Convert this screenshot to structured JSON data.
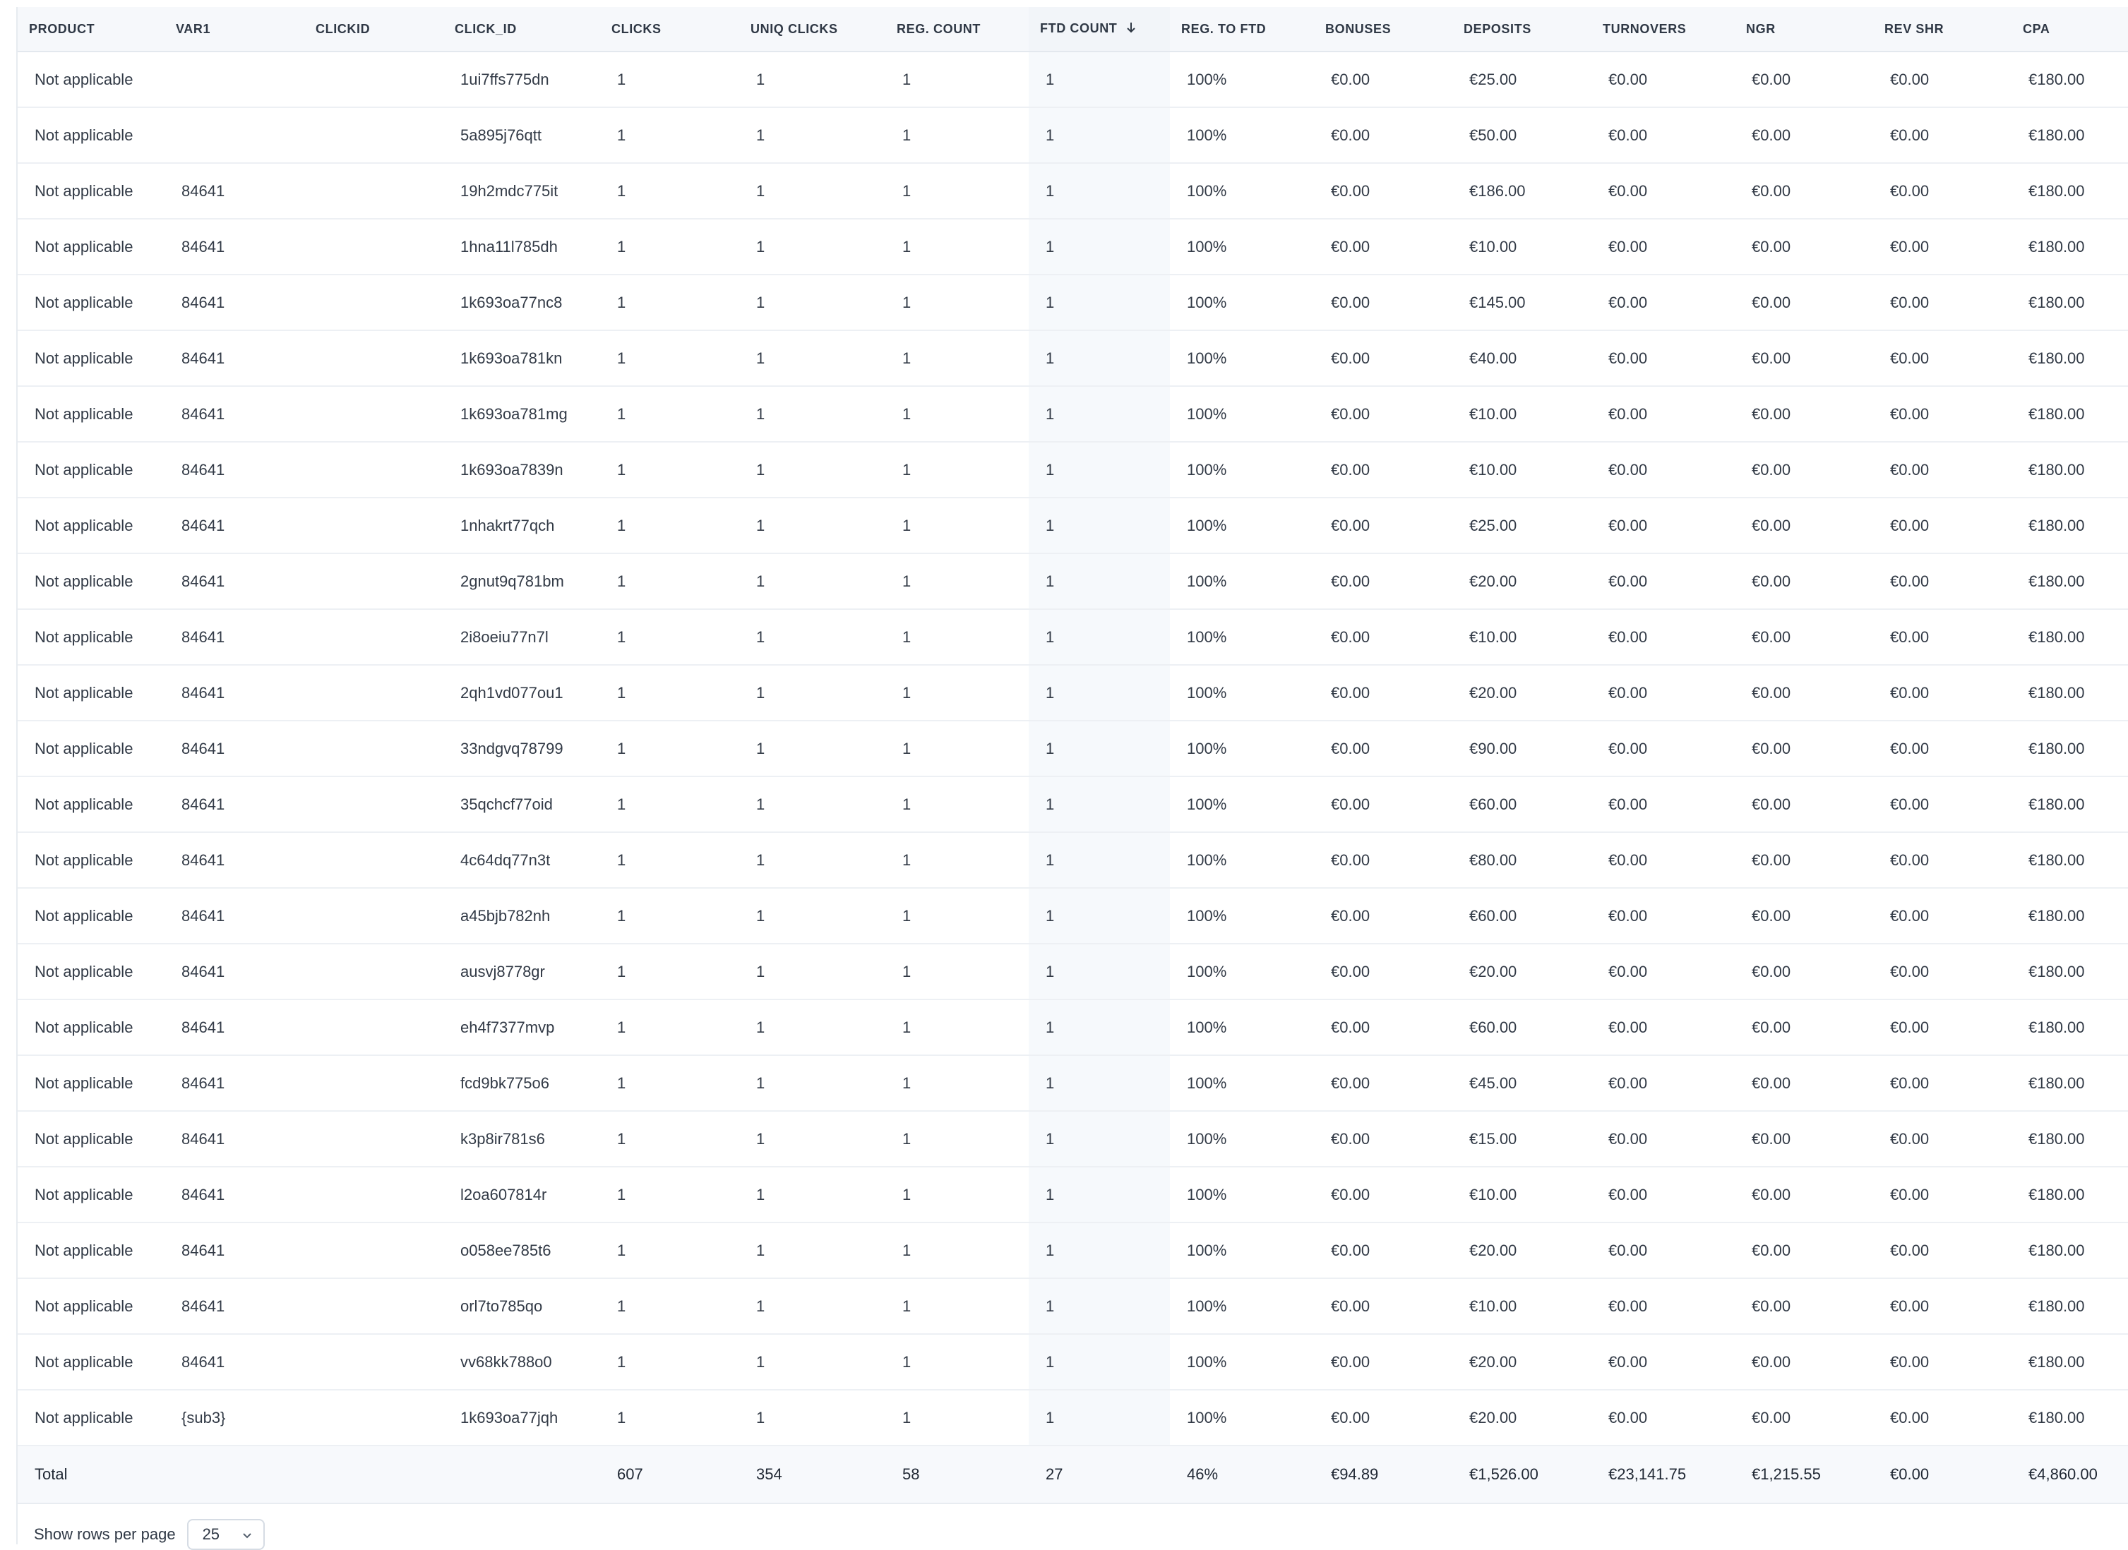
{
  "table": {
    "columns": [
      "PRODUCT",
      "VAR1",
      "CLICKID",
      "CLICK_ID",
      "CLICKS",
      "UNIQ CLICKS",
      "REG. COUNT",
      "FTD COUNT",
      "REG. TO FTD",
      "BONUSES",
      "DEPOSITS",
      "TURNOVERS",
      "NGR",
      "REV SHR",
      "CPA"
    ],
    "sorted_column_index": 7,
    "rows": [
      [
        "Not applicable",
        "",
        "",
        "1ui7ffs775dn",
        "1",
        "1",
        "1",
        "1",
        "100%",
        "€0.00",
        "€25.00",
        "€0.00",
        "€0.00",
        "€0.00",
        "€180.00"
      ],
      [
        "Not applicable",
        "",
        "",
        "5a895j76qtt",
        "1",
        "1",
        "1",
        "1",
        "100%",
        "€0.00",
        "€50.00",
        "€0.00",
        "€0.00",
        "€0.00",
        "€180.00"
      ],
      [
        "Not applicable",
        "84641",
        "",
        "19h2mdc775it",
        "1",
        "1",
        "1",
        "1",
        "100%",
        "€0.00",
        "€186.00",
        "€0.00",
        "€0.00",
        "€0.00",
        "€180.00"
      ],
      [
        "Not applicable",
        "84641",
        "",
        "1hna11l785dh",
        "1",
        "1",
        "1",
        "1",
        "100%",
        "€0.00",
        "€10.00",
        "€0.00",
        "€0.00",
        "€0.00",
        "€180.00"
      ],
      [
        "Not applicable",
        "84641",
        "",
        "1k693oa77nc8",
        "1",
        "1",
        "1",
        "1",
        "100%",
        "€0.00",
        "€145.00",
        "€0.00",
        "€0.00",
        "€0.00",
        "€180.00"
      ],
      [
        "Not applicable",
        "84641",
        "",
        "1k693oa781kn",
        "1",
        "1",
        "1",
        "1",
        "100%",
        "€0.00",
        "€40.00",
        "€0.00",
        "€0.00",
        "€0.00",
        "€180.00"
      ],
      [
        "Not applicable",
        "84641",
        "",
        "1k693oa781mg",
        "1",
        "1",
        "1",
        "1",
        "100%",
        "€0.00",
        "€10.00",
        "€0.00",
        "€0.00",
        "€0.00",
        "€180.00"
      ],
      [
        "Not applicable",
        "84641",
        "",
        "1k693oa7839n",
        "1",
        "1",
        "1",
        "1",
        "100%",
        "€0.00",
        "€10.00",
        "€0.00",
        "€0.00",
        "€0.00",
        "€180.00"
      ],
      [
        "Not applicable",
        "84641",
        "",
        "1nhakrt77qch",
        "1",
        "1",
        "1",
        "1",
        "100%",
        "€0.00",
        "€25.00",
        "€0.00",
        "€0.00",
        "€0.00",
        "€180.00"
      ],
      [
        "Not applicable",
        "84641",
        "",
        "2gnut9q781bm",
        "1",
        "1",
        "1",
        "1",
        "100%",
        "€0.00",
        "€20.00",
        "€0.00",
        "€0.00",
        "€0.00",
        "€180.00"
      ],
      [
        "Not applicable",
        "84641",
        "",
        "2i8oeiu77n7l",
        "1",
        "1",
        "1",
        "1",
        "100%",
        "€0.00",
        "€10.00",
        "€0.00",
        "€0.00",
        "€0.00",
        "€180.00"
      ],
      [
        "Not applicable",
        "84641",
        "",
        "2qh1vd077ou1",
        "1",
        "1",
        "1",
        "1",
        "100%",
        "€0.00",
        "€20.00",
        "€0.00",
        "€0.00",
        "€0.00",
        "€180.00"
      ],
      [
        "Not applicable",
        "84641",
        "",
        "33ndgvq78799",
        "1",
        "1",
        "1",
        "1",
        "100%",
        "€0.00",
        "€90.00",
        "€0.00",
        "€0.00",
        "€0.00",
        "€180.00"
      ],
      [
        "Not applicable",
        "84641",
        "",
        "35qchcf77oid",
        "1",
        "1",
        "1",
        "1",
        "100%",
        "€0.00",
        "€60.00",
        "€0.00",
        "€0.00",
        "€0.00",
        "€180.00"
      ],
      [
        "Not applicable",
        "84641",
        "",
        "4c64dq77n3t",
        "1",
        "1",
        "1",
        "1",
        "100%",
        "€0.00",
        "€80.00",
        "€0.00",
        "€0.00",
        "€0.00",
        "€180.00"
      ],
      [
        "Not applicable",
        "84641",
        "",
        "a45bjb782nh",
        "1",
        "1",
        "1",
        "1",
        "100%",
        "€0.00",
        "€60.00",
        "€0.00",
        "€0.00",
        "€0.00",
        "€180.00"
      ],
      [
        "Not applicable",
        "84641",
        "",
        "ausvj8778gr",
        "1",
        "1",
        "1",
        "1",
        "100%",
        "€0.00",
        "€20.00",
        "€0.00",
        "€0.00",
        "€0.00",
        "€180.00"
      ],
      [
        "Not applicable",
        "84641",
        "",
        "eh4f7377mvp",
        "1",
        "1",
        "1",
        "1",
        "100%",
        "€0.00",
        "€60.00",
        "€0.00",
        "€0.00",
        "€0.00",
        "€180.00"
      ],
      [
        "Not applicable",
        "84641",
        "",
        "fcd9bk775o6",
        "1",
        "1",
        "1",
        "1",
        "100%",
        "€0.00",
        "€45.00",
        "€0.00",
        "€0.00",
        "€0.00",
        "€180.00"
      ],
      [
        "Not applicable",
        "84641",
        "",
        "k3p8ir781s6",
        "1",
        "1",
        "1",
        "1",
        "100%",
        "€0.00",
        "€15.00",
        "€0.00",
        "€0.00",
        "€0.00",
        "€180.00"
      ],
      [
        "Not applicable",
        "84641",
        "",
        "l2oa607814r",
        "1",
        "1",
        "1",
        "1",
        "100%",
        "€0.00",
        "€10.00",
        "€0.00",
        "€0.00",
        "€0.00",
        "€180.00"
      ],
      [
        "Not applicable",
        "84641",
        "",
        "o058ee785t6",
        "1",
        "1",
        "1",
        "1",
        "100%",
        "€0.00",
        "€20.00",
        "€0.00",
        "€0.00",
        "€0.00",
        "€180.00"
      ],
      [
        "Not applicable",
        "84641",
        "",
        "orl7to785qo",
        "1",
        "1",
        "1",
        "1",
        "100%",
        "€0.00",
        "€10.00",
        "€0.00",
        "€0.00",
        "€0.00",
        "€180.00"
      ],
      [
        "Not applicable",
        "84641",
        "",
        "vv68kk788o0",
        "1",
        "1",
        "1",
        "1",
        "100%",
        "€0.00",
        "€20.00",
        "€0.00",
        "€0.00",
        "€0.00",
        "€180.00"
      ],
      [
        "Not applicable",
        "{sub3}",
        "",
        "1k693oa77jqh",
        "1",
        "1",
        "1",
        "1",
        "100%",
        "€0.00",
        "€20.00",
        "€0.00",
        "€0.00",
        "€0.00",
        "€180.00"
      ]
    ],
    "total": [
      "Total",
      "",
      "",
      "",
      "607",
      "354",
      "58",
      "27",
      "46%",
      "€94.89",
      "€1,526.00",
      "€23,141.75",
      "€1,215.55",
      "€0.00",
      "€4,860.00"
    ]
  },
  "pagination": {
    "label": "Show rows per page",
    "rows_per_page": "25",
    "icon": "chevron-down-icon"
  },
  "icons": {
    "sort": "arrow-down-icon"
  },
  "colors": {
    "header_bg": "#f6f8fb",
    "sorted_col_bg": "#f6f9fc",
    "row_border": "#edf0f4"
  }
}
